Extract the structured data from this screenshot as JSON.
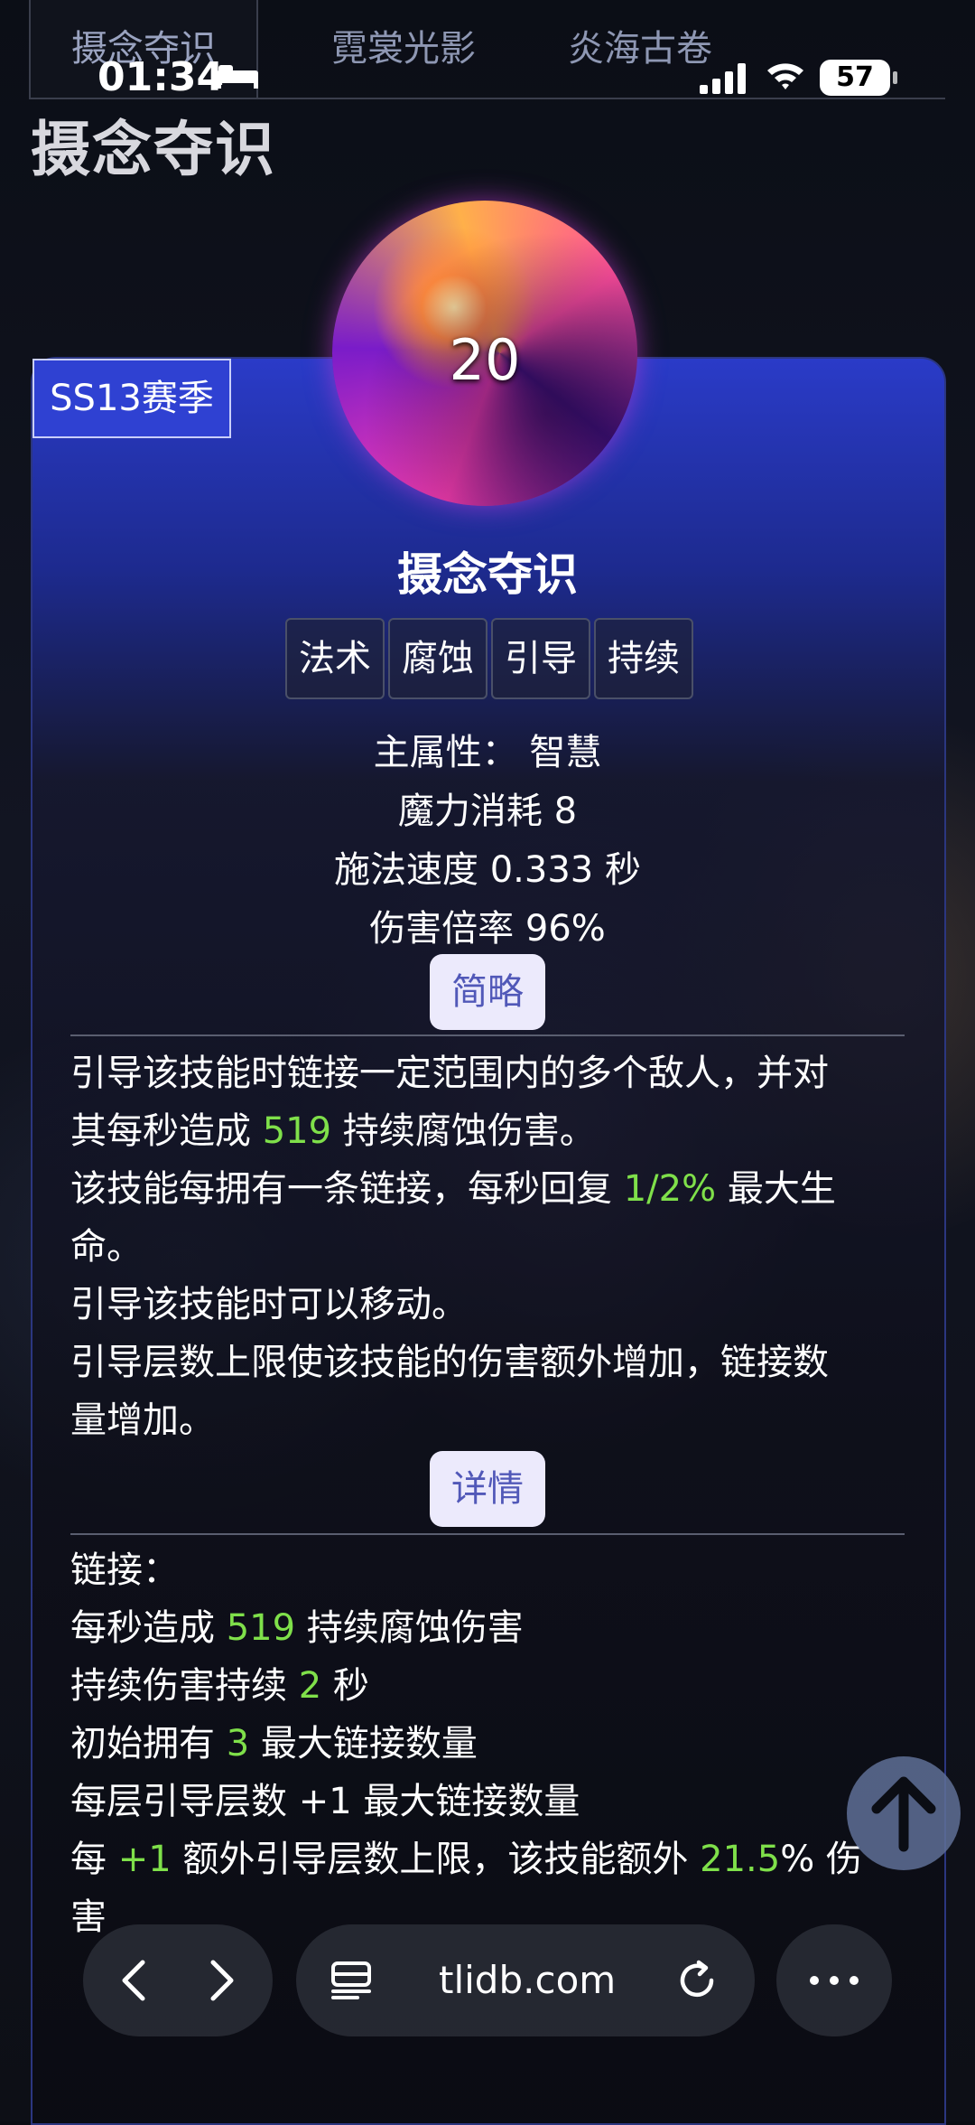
{
  "status_bar": {
    "time": "01:34",
    "battery": "57"
  },
  "tabs": [
    {
      "label": "摄念夺识",
      "active": true
    },
    {
      "label": "霓裳光影",
      "active": false
    },
    {
      "label": "炎海古卷",
      "active": false
    }
  ],
  "page_title": "摄念夺识",
  "card": {
    "season": "SS13赛季",
    "level": "20",
    "skill_name": "摄念夺识",
    "tags": [
      "法术",
      "腐蚀",
      "引导",
      "持续"
    ],
    "stats": {
      "main_attr": "主属性：  智慧",
      "mana": "魔力消耗  8",
      "cast_speed": "施法速度  0.333 秒",
      "damage_mult": "伤害倍率  96%"
    },
    "brief_button": "简略",
    "description": {
      "l1a": "引导该技能时链接一定范围内的多个敌人，并对",
      "l1b_pre": "其每秒造成 ",
      "l1b_val": "519",
      "l1b_post": " 持续腐蚀伤害。",
      "l2a_pre": "该技能每拥有一条链接，每秒回复 ",
      "l2a_val": "1/2%",
      "l2a_post": " 最大生",
      "l2b": "命。",
      "l3": "引导该技能时可以移动。",
      "l4a": "引导层数上限使该技能的伤害额外增加，链接数",
      "l4b": "量增加。"
    },
    "detail_button": "详情",
    "details": {
      "heading": "链接：",
      "d1_pre": "每秒造成 ",
      "d1_val": "519",
      "d1_post": " 持续腐蚀伤害",
      "d2_pre": "持续伤害持续 ",
      "d2_val": "2",
      "d2_post": " 秒",
      "d3_pre": "初始拥有 ",
      "d3_val": "3",
      "d3_post": " 最大链接数量",
      "d4": "每层引导层数 +1 最大链接数量",
      "d5_pre": "每 ",
      "d5_val1": "+1",
      "d5_mid": " 额外引导层数上限，该技能额外 ",
      "d5_val2": "21.5",
      "d5_post": "% 伤",
      "d5b": "害"
    }
  },
  "browser": {
    "url": "tlidb.com"
  },
  "colors": {
    "accent_green": "#7fe04a",
    "season_blue": "#2f41d2"
  }
}
